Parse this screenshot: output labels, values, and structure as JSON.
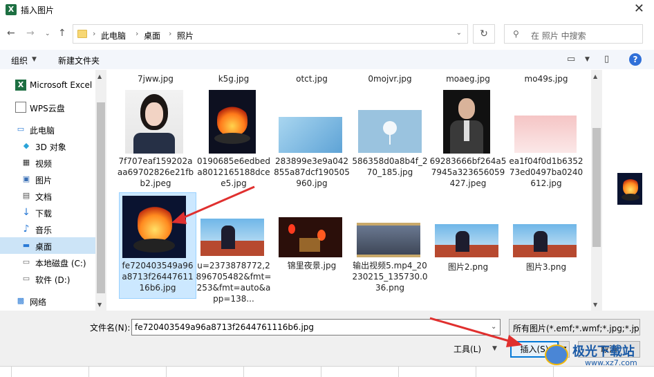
{
  "window": {
    "title": "插入图片",
    "app_icon": "X"
  },
  "address": {
    "crumbs": [
      "此电脑",
      "桌面",
      "照片"
    ],
    "search_placeholder": "在 照片 中搜索"
  },
  "toolbar": {
    "organize": "组织",
    "new_folder": "新建文件夹"
  },
  "sidebar": {
    "items": [
      {
        "label": "Microsoft Excel",
        "icon": "excel-icon"
      },
      {
        "label": "WPS云盘",
        "icon": "cloud-doc-icon"
      },
      {
        "label": "此电脑",
        "icon": "computer-icon"
      },
      {
        "label": "3D 对象",
        "icon": "3d-objects-icon"
      },
      {
        "label": "视频",
        "icon": "video-icon"
      },
      {
        "label": "图片",
        "icon": "pictures-icon"
      },
      {
        "label": "文档",
        "icon": "documents-icon"
      },
      {
        "label": "下载",
        "icon": "download-icon"
      },
      {
        "label": "音乐",
        "icon": "music-icon"
      },
      {
        "label": "桌面",
        "icon": "desktop-icon"
      },
      {
        "label": "本地磁盘 (C:)",
        "icon": "drive-icon"
      },
      {
        "label": "软件 (D:)",
        "icon": "drive-icon"
      },
      {
        "label": "网络",
        "icon": "network-icon"
      }
    ]
  },
  "files": {
    "top_row": [
      "7jww.jpg",
      "k5g.jpg",
      "otct.jpg",
      "0mojvr.jpg",
      "moaeg.jpg",
      "mo49s.jpg"
    ],
    "row1": [
      "7f707eaf159202aaa69702826e21fbb2.jpeg",
      "0190685e6edbeda8012165188dcee5.jpg",
      "283899e3e9a042855a87dcf190505960.jpg",
      "586358d0a8b4f_270_185.jpg",
      "69283666bf264a57945a323656059427.jpeg",
      "ea1f04f0d1b635273ed0497ba0240612.jpg"
    ],
    "row2": [
      "fe720403549a96a8713f2644761116b6.jpg",
      "u=2373878772,2896705482&fmt=253&fmt=auto&app=138...",
      "锦里夜景.jpg",
      "输出视频5.mp4_20230215_135730.036.png",
      "图片2.png",
      "图片3.png"
    ]
  },
  "bottom": {
    "filename_label": "文件名(N):",
    "filename_value": "fe720403549a96a8713f2644761116b6.jpg",
    "filter_value": "所有图片(*.emf;*.wmf;*.jpg;*.jp",
    "tools_label": "工具(L)",
    "insert_label": "插入(S)",
    "cancel_label": "取消"
  },
  "watermark": {
    "title": "极光下载站",
    "url": "www.xz7.com"
  },
  "colors": {
    "accent": "#0078d7",
    "selection": "#cce8ff",
    "arrow": "#e0302f"
  }
}
